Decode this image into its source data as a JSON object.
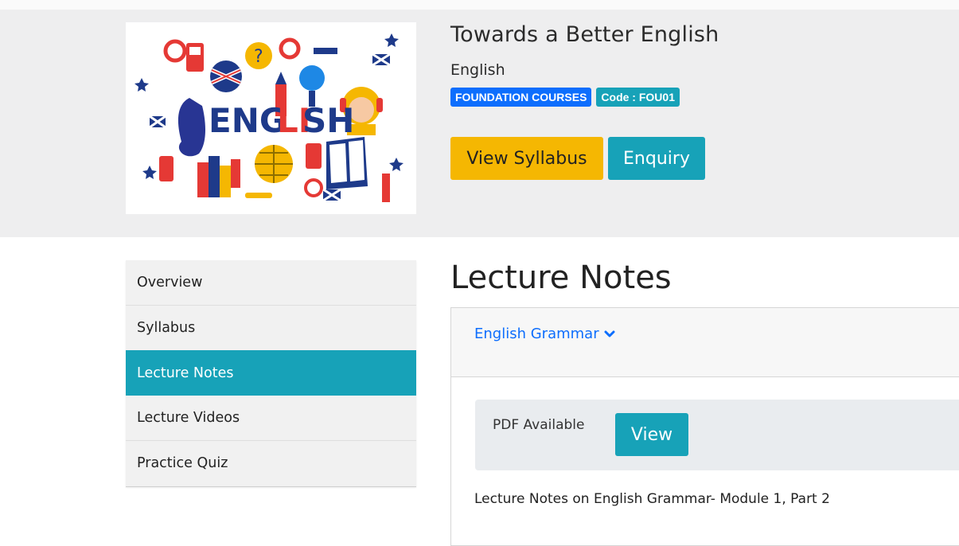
{
  "course": {
    "title": "Towards a Better English",
    "subject": "English",
    "category_badge": "FOUNDATION COURSES",
    "code_badge": "Code : FOU01",
    "image_text": "ENGLISH",
    "view_syllabus_label": "View Syllabus",
    "enquiry_label": "Enquiry"
  },
  "sidebar": {
    "items": [
      {
        "label": "Overview",
        "active": false
      },
      {
        "label": "Syllabus",
        "active": false
      },
      {
        "label": "Lecture Notes",
        "active": true
      },
      {
        "label": "Lecture Videos",
        "active": false
      },
      {
        "label": "Practice Quiz",
        "active": false
      }
    ]
  },
  "main": {
    "heading": "Lecture Notes",
    "accordion": {
      "title": "English Grammar",
      "icon": "chevron-down-icon",
      "pdf_label": "PDF Available",
      "view_label": "View",
      "description": "Lecture Notes on English Grammar- Module 1, Part 2"
    }
  },
  "colors": {
    "teal": "#17a2b8",
    "yellow": "#f5b702",
    "blue": "#0d6efd",
    "hero_bg": "#eeeeef"
  }
}
